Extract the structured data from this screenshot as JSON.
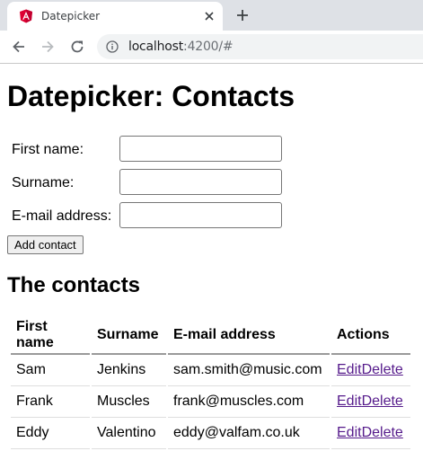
{
  "browser": {
    "tab_title": "Datepicker",
    "url_host": "localhost",
    "url_rest": ":4200/#"
  },
  "page": {
    "title": "Datepicker: Contacts",
    "form": {
      "first_name_label": "First name:",
      "surname_label": "Surname:",
      "email_label": "E-mail address:",
      "first_name_value": "",
      "surname_value": "",
      "email_value": ""
    },
    "add_button_label": "Add contact",
    "contacts_heading": "The contacts",
    "table": {
      "headers": [
        "First name",
        "Surname",
        "E-mail address",
        "Actions"
      ],
      "rows": [
        {
          "first_name": "Sam",
          "surname": "Jenkins",
          "email": "sam.smith@music.com",
          "edit": "Edit",
          "delete": "Delete"
        },
        {
          "first_name": "Frank",
          "surname": "Muscles",
          "email": "frank@muscles.com",
          "edit": "Edit",
          "delete": "Delete"
        },
        {
          "first_name": "Eddy",
          "surname": "Valentino",
          "email": "eddy@valfam.co.uk",
          "edit": "Edit",
          "delete": "Delete"
        }
      ]
    }
  },
  "colors": {
    "link_visited": "#551a8b",
    "angular_red": "#dd0031"
  }
}
